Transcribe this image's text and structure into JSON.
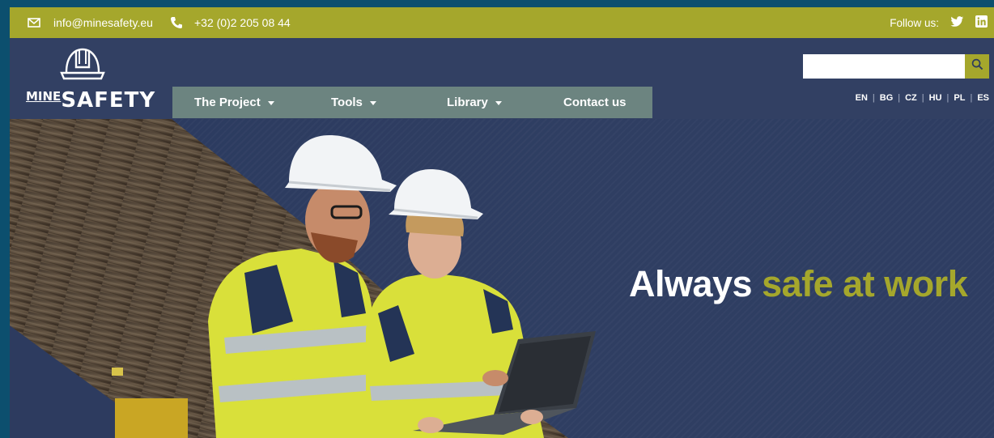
{
  "topbar": {
    "email": "info@minesafety.eu",
    "phone": "+32 (0)2 205 08 44",
    "follow_label": "Follow us:",
    "icons": {
      "email": "envelope-icon",
      "phone": "phone-icon",
      "twitter": "twitter-icon",
      "linkedin": "linkedin-icon"
    }
  },
  "logo": {
    "prefix": "MINE",
    "name": "SAFETY",
    "icon": "hard-hat-icon"
  },
  "nav": [
    {
      "label": "The Project",
      "has_dropdown": true
    },
    {
      "label": "Tools",
      "has_dropdown": true
    },
    {
      "label": "Library",
      "has_dropdown": true
    },
    {
      "label": "Contact us",
      "has_dropdown": false
    }
  ],
  "search": {
    "value": "",
    "placeholder": "",
    "icon": "search-icon"
  },
  "languages": [
    "EN",
    "BG",
    "CZ",
    "HU",
    "PL",
    "ES"
  ],
  "hero": {
    "headline_plain": "Always",
    "headline_accent": "safe at work"
  },
  "colors": {
    "olive": "#a5a72c",
    "navy": "#324063",
    "nav_gray": "#6c8480",
    "outer": "#0c4f6e"
  }
}
